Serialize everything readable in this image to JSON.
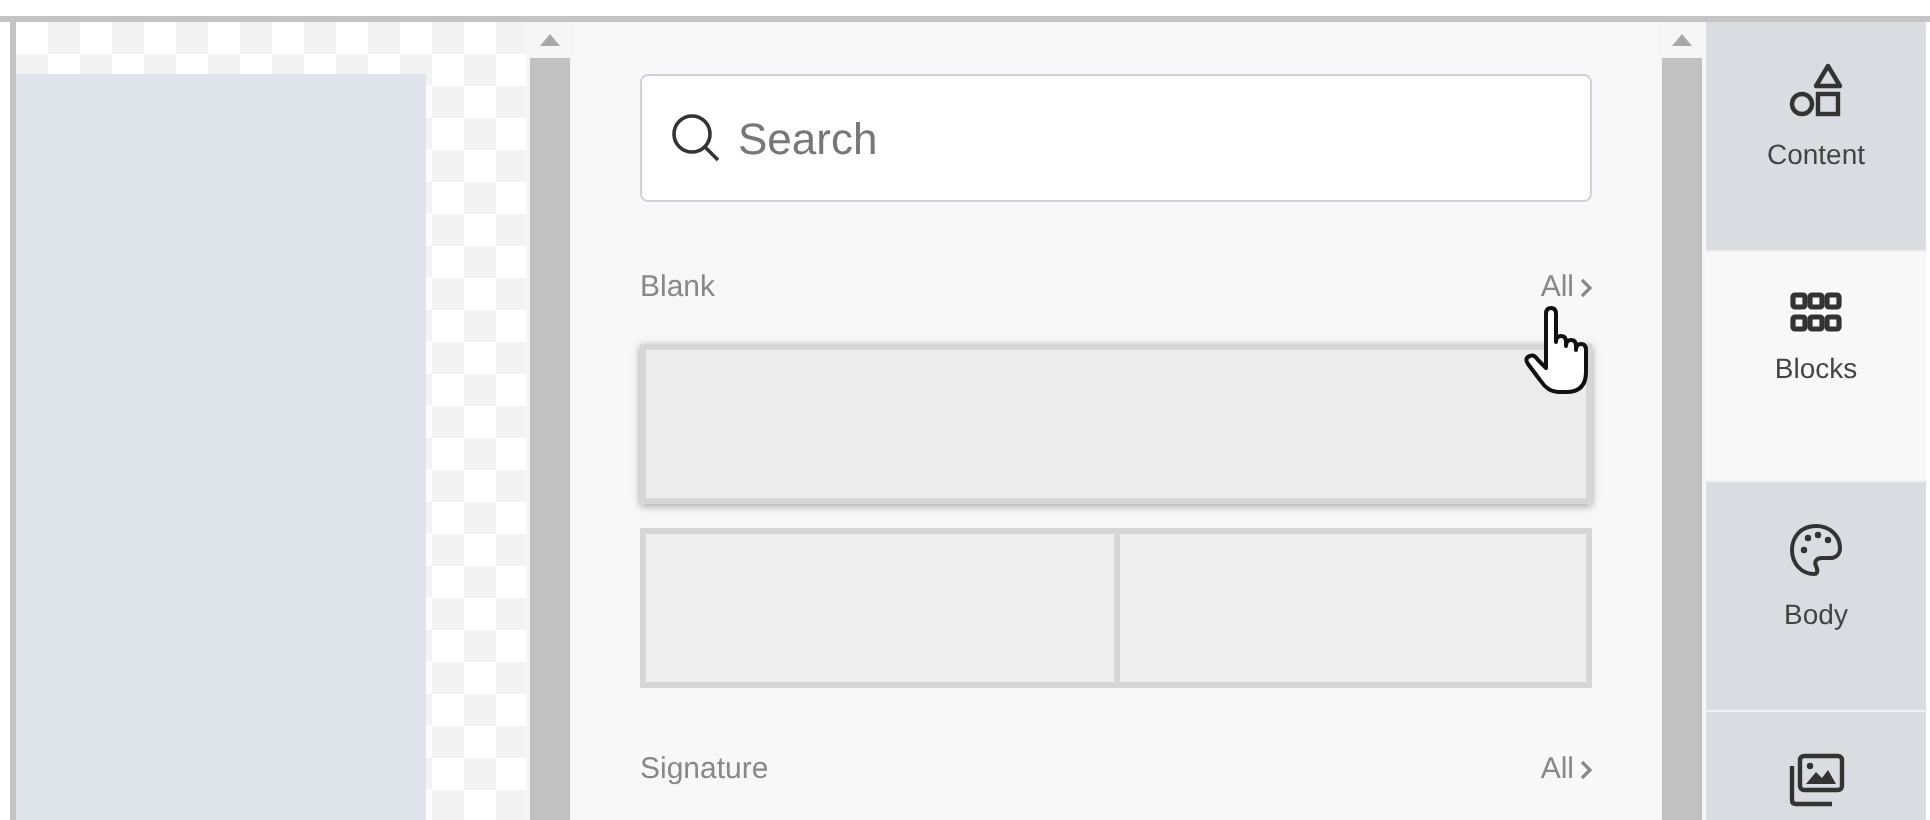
{
  "search": {
    "placeholder": "Search"
  },
  "sections": [
    {
      "title": "Blank",
      "link": "All",
      "rows": [
        {
          "kind": "single",
          "hovered": true
        },
        {
          "kind": "split",
          "hovered": false
        }
      ]
    },
    {
      "title": "Signature",
      "link": "All"
    }
  ],
  "tabs": [
    {
      "label": "Content",
      "selected": false
    },
    {
      "label": "Blocks",
      "selected": true
    },
    {
      "label": "Body",
      "selected": false
    },
    {
      "selected": false
    }
  ]
}
